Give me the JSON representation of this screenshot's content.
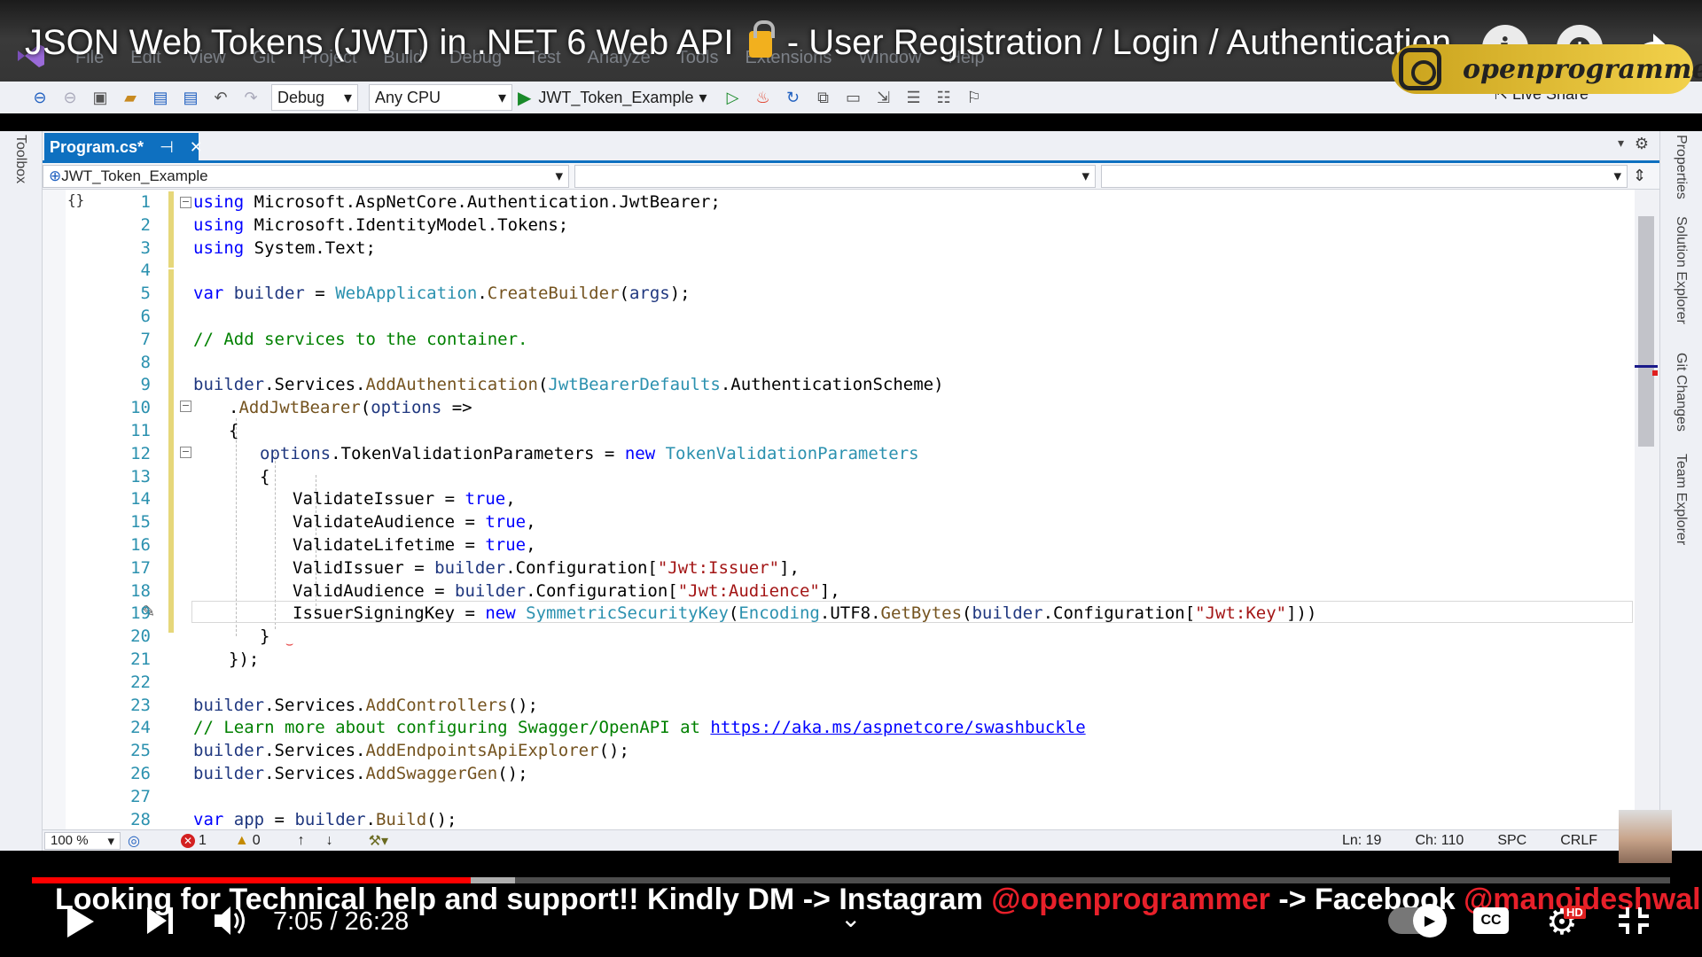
{
  "video": {
    "title_part1": "JSON Web Tokens (JWT) in .NET 6 Web API",
    "title_part2": "- User Registration / Login / Authentication",
    "channel_badge": "openprogrammer",
    "current_time": "7:05",
    "duration": "26:28",
    "time_separator": " / ",
    "progress_fraction": 0.268,
    "buffered_fraction": 0.295,
    "caption_pre": "Looking for Technical help and support!! Kindly DM -> Instagram ",
    "caption_handle1": "@openprogrammer",
    "caption_mid": "  -> Facebook ",
    "caption_handle2": "@manojdeshwal",
    "hd_badge": "HD",
    "cc_label": "CC",
    "accent_color": "#ff0000"
  },
  "menubar": [
    "File",
    "Edit",
    "View",
    "Git",
    "Project",
    "Build",
    "Debug",
    "Test",
    "Analyze",
    "Tools",
    "Extensions",
    "Window",
    "Help"
  ],
  "toolbar": {
    "config": "Debug",
    "platform": "Any CPU",
    "run_target": "JWT_Token_Example",
    "live_share": "Live Share"
  },
  "side_left": {
    "toolbox": "Toolbox"
  },
  "side_right": {
    "properties": "Properties",
    "solution_explorer": "Solution Explorer",
    "git_changes": "Git Changes",
    "team_explorer": "Team Explorer"
  },
  "tab": {
    "filename": "Program.cs*",
    "pin": "⊣",
    "close": "✕"
  },
  "navbar": {
    "project": "JWT_Token_Example"
  },
  "code_lines": [
    {
      "n": "1"
    },
    {
      "n": "2"
    },
    {
      "n": "3"
    },
    {
      "n": "4"
    },
    {
      "n": "5"
    },
    {
      "n": "6"
    },
    {
      "n": "7"
    },
    {
      "n": "8"
    },
    {
      "n": "9"
    },
    {
      "n": "10"
    },
    {
      "n": "11"
    },
    {
      "n": "12"
    },
    {
      "n": "13"
    },
    {
      "n": "14"
    },
    {
      "n": "15"
    },
    {
      "n": "16"
    },
    {
      "n": "17"
    },
    {
      "n": "18"
    },
    {
      "n": "19"
    },
    {
      "n": "20"
    },
    {
      "n": "21"
    },
    {
      "n": "22"
    },
    {
      "n": "23"
    },
    {
      "n": "24"
    },
    {
      "n": "25"
    },
    {
      "n": "26"
    },
    {
      "n": "27"
    },
    {
      "n": "28"
    }
  ],
  "code": {
    "l1": [
      "using",
      " Microsoft.AspNetCore.Authentication.JwtBearer;"
    ],
    "l2": [
      "using",
      " Microsoft.IdentityModel.Tokens;"
    ],
    "l3": [
      "using",
      " System.Text;"
    ],
    "l5": [
      "var",
      " ",
      "builder",
      " = ",
      "WebApplication",
      ".",
      "CreateBuilder",
      "(",
      "args",
      ");"
    ],
    "l7": "// Add services to the container.",
    "l9": [
      "builder",
      ".Services.",
      "AddAuthentication",
      "(",
      "JwtBearerDefaults",
      ".AuthenticationScheme)"
    ],
    "l10": [
      ".",
      "AddJwtBearer",
      "(",
      "options",
      " =>"
    ],
    "l11": "{",
    "l12": [
      "options",
      ".TokenValidationParameters = ",
      "new",
      " ",
      "TokenValidationParameters"
    ],
    "l13": "{",
    "l14": [
      "ValidateIssuer = ",
      "true",
      ","
    ],
    "l15": [
      "ValidateAudience = ",
      "true",
      ","
    ],
    "l16": [
      "ValidateLifetime = ",
      "true",
      ","
    ],
    "l17": [
      "ValidIssuer = ",
      "builder",
      ".Configuration[",
      "\"Jwt:Issuer\"",
      "],"
    ],
    "l18": [
      "ValidAudience = ",
      "builder",
      ".Configuration[",
      "\"Jwt:Audience\"",
      "],"
    ],
    "l19": [
      "IssuerSigningKey = ",
      "new",
      " ",
      "SymmetricSecurityKey",
      "(",
      "Encoding",
      ".UTF8.",
      "GetBytes",
      "(",
      "builder",
      ".Configuration[",
      "\"Jwt:Key\"",
      "]))"
    ],
    "l20": "}",
    "l21": "});",
    "l23": [
      "builder",
      ".Services.",
      "AddControllers",
      "();"
    ],
    "l24": [
      "// Learn more about configuring Swagger/OpenAPI at ",
      "https://aka.ms/aspnetcore/swashbuckle"
    ],
    "l25": [
      "builder",
      ".Services.",
      "AddEndpointsApiExplorer",
      "();"
    ],
    "l26": [
      "builder",
      ".Services.",
      "AddSwaggerGen",
      "();"
    ],
    "l28": [
      "var",
      " ",
      "app",
      " = ",
      "builder",
      ".",
      "Build",
      "();"
    ]
  },
  "status": {
    "zoom": "100 %",
    "errors": "1",
    "warnings": "0",
    "line": "Ln: 19",
    "col": "Ch: 110",
    "indent": "SPC",
    "eol": "CRLF"
  }
}
